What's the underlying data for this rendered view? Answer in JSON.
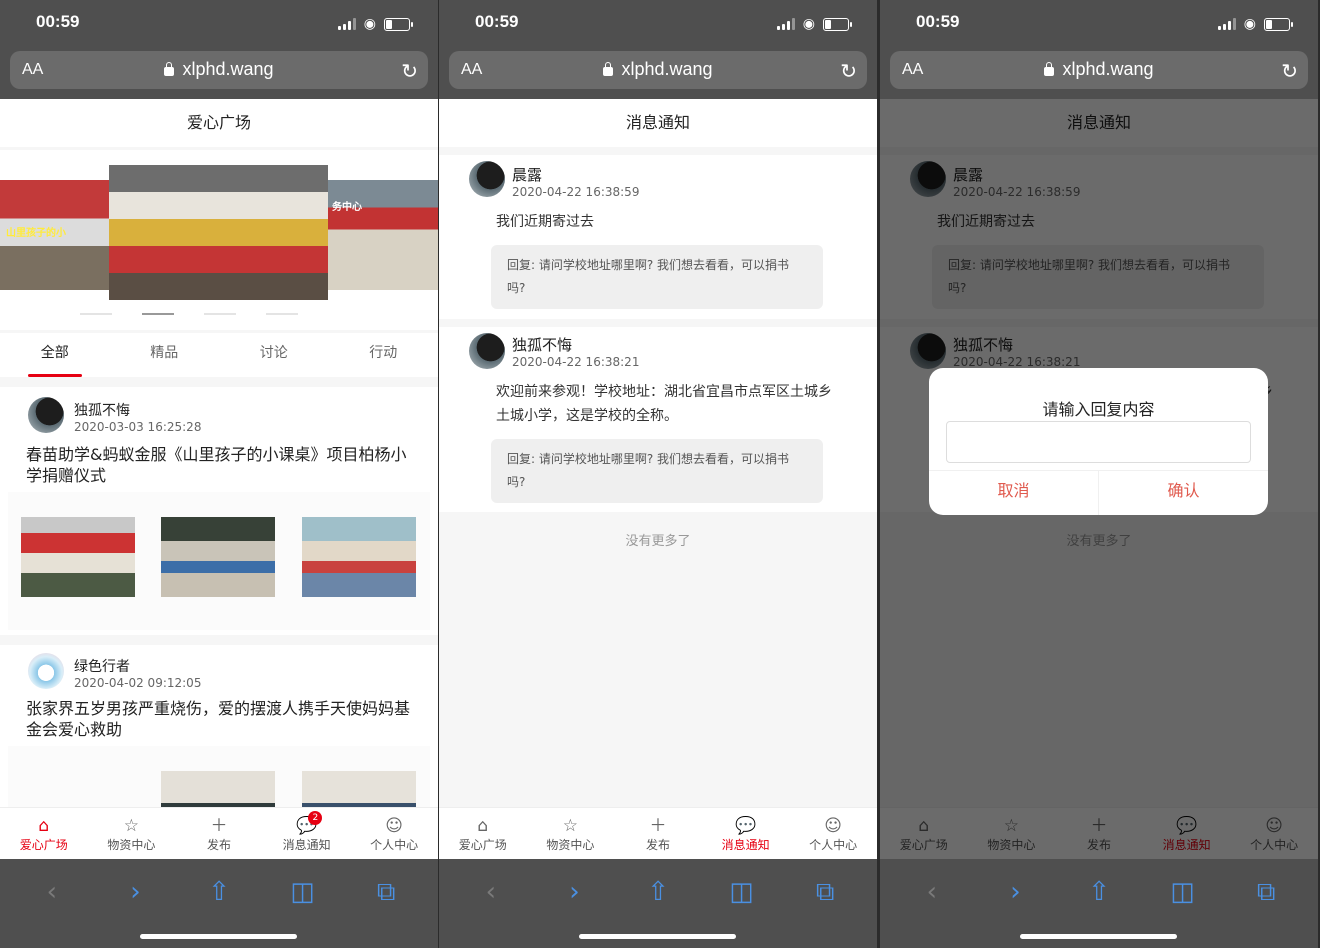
{
  "status": {
    "time": "00:59"
  },
  "browser": {
    "aa": "AA",
    "url": "xlphd.wang",
    "reload_icon": "reload-icon"
  },
  "toolbar_icons": [
    "back-icon",
    "forward-icon",
    "share-icon",
    "bookmarks-icon",
    "tabs-icon"
  ],
  "screen1": {
    "title": "爱心广场",
    "carousel_caption": "山里孩子的小",
    "carousel_right_caption": "务中心",
    "tabs": [
      "全部",
      "精品",
      "讨论",
      "行动"
    ],
    "posts": [
      {
        "user": "独孤不悔",
        "time": "2020-03-03 16:25:28",
        "title": "春苗助学&蚂蚁金服《山里孩子的小课桌》项目柏杨小学捐赠仪式"
      },
      {
        "user": "绿色行者",
        "time": "2020-04-02 09:12:05",
        "title": "张家界五岁男孩严重烧伤，爱的摆渡人携手天使妈妈基金会爱心救助"
      }
    ]
  },
  "messages_screen": {
    "title": "消息通知",
    "messages": [
      {
        "user": "晨露",
        "time": "2020-04-22 16:38:59",
        "body": "我们近期寄过去",
        "quote": "回复: 请问学校地址哪里啊? 我们想去看看，可以捐书吗?"
      },
      {
        "user": "独孤不悔",
        "time": "2020-04-22 16:38:21",
        "body": "欢迎前来参观！学校地址：湖北省宜昌市点军区土城乡土城小学，这是学校的全称。",
        "quote": "回复: 请问学校地址哪里啊? 我们想去看看，可以捐书吗?"
      }
    ],
    "no_more": "没有更多了"
  },
  "tabbar": {
    "items": [
      {
        "label": "爱心广场",
        "icon": "home-icon"
      },
      {
        "label": "物资中心",
        "icon": "star-icon"
      },
      {
        "label": "发布",
        "icon": "plus-icon"
      },
      {
        "label": "消息通知",
        "icon": "message-icon"
      },
      {
        "label": "个人中心",
        "icon": "user-icon"
      }
    ],
    "badge": "2"
  },
  "dialog": {
    "title": "请输入回复内容",
    "input_value": "",
    "cancel": "取消",
    "confirm": "确认"
  },
  "colors": {
    "accent": "#e60012",
    "dialog_button": "#e05a4e",
    "chrome": "#4f4f4f",
    "link": "#4a90e2"
  }
}
